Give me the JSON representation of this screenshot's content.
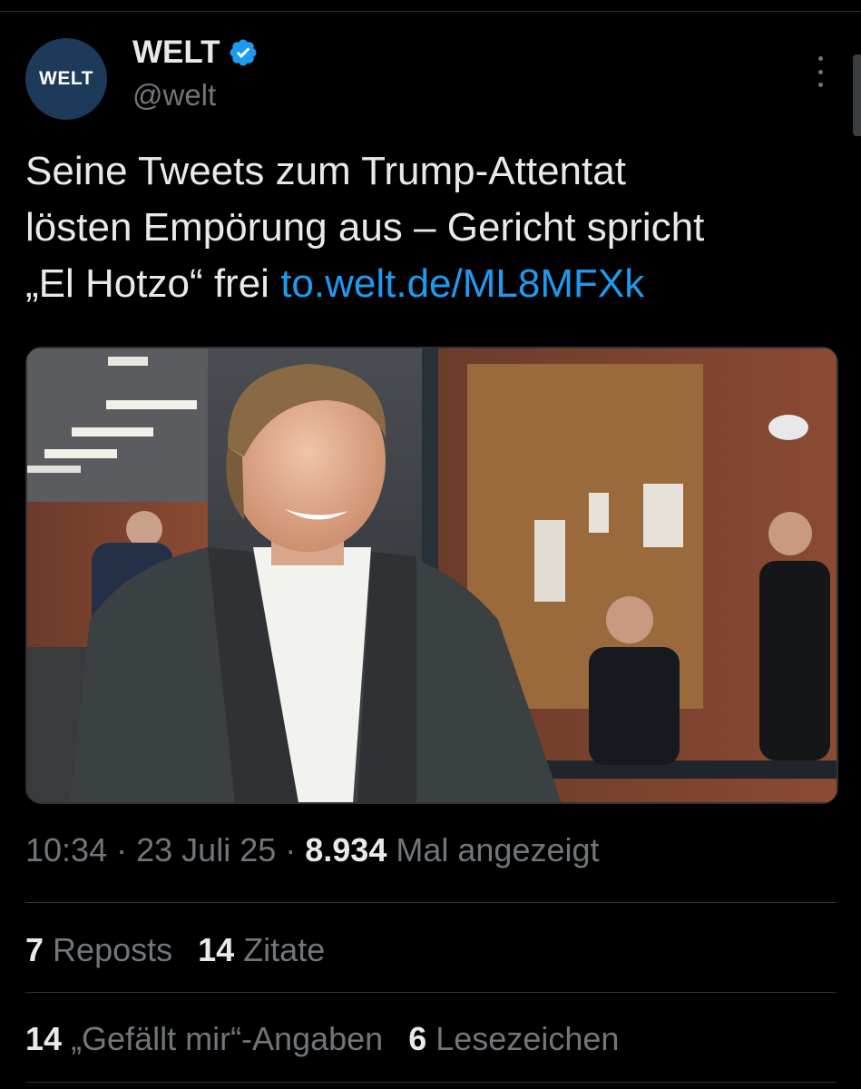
{
  "account": {
    "avatar_text": "WELT",
    "display_name": "WELT",
    "handle": "@welt",
    "verified_color": "#1d9bf0"
  },
  "tweet": {
    "text_line1": "Seine Tweets zum Trump-Attentat",
    "text_line2": "lösten Empörung aus – Gericht spricht",
    "text_line3": "„El Hotzo“ frei",
    "link": "to.welt.de/ML8MFXk"
  },
  "media": {
    "description": "photo"
  },
  "meta": {
    "time": "10:34",
    "separator1": "·",
    "date": "23 Juli 25",
    "separator2": "·",
    "views_count": "8.934",
    "views_label": "Mal angezeigt"
  },
  "stats": {
    "reposts_count": "7",
    "reposts_label": "Reposts",
    "quotes_count": "14",
    "quotes_label": "Zitate",
    "likes_count": "14",
    "likes_label": "„Gefällt mir“-Angaben",
    "bookmarks_count": "6",
    "bookmarks_label": "Lesezeichen"
  },
  "colors": {
    "background": "#000000",
    "text": "#e7e9ea",
    "secondary": "#71767b",
    "link": "#1d9bf0",
    "divider": "#2f3336"
  }
}
